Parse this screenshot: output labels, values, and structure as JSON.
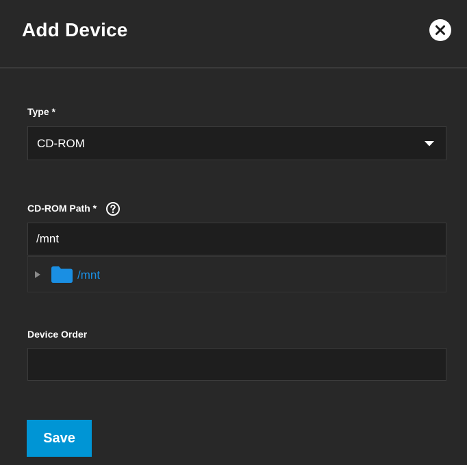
{
  "dialog": {
    "title": "Add Device",
    "close_icon": "close-icon"
  },
  "form": {
    "type": {
      "label": "Type *",
      "selected_value": "CD-ROM",
      "icon": "chevron-down-icon"
    },
    "cdrom_path": {
      "label": "CD-ROM Path *",
      "help_icon": "help-circle-icon",
      "value": "/mnt",
      "tree": {
        "items": [
          {
            "label": "/mnt",
            "icon": "folder-icon",
            "expand_icon": "triangle-right-icon"
          }
        ]
      }
    },
    "device_order": {
      "label": "Device Order",
      "value": ""
    }
  },
  "actions": {
    "save_label": "Save"
  },
  "colors": {
    "background": "#282828",
    "field_background": "#1e1e1e",
    "accent": "#0095d5",
    "link": "#1a8fe3",
    "folder": "#1a8fe3"
  }
}
